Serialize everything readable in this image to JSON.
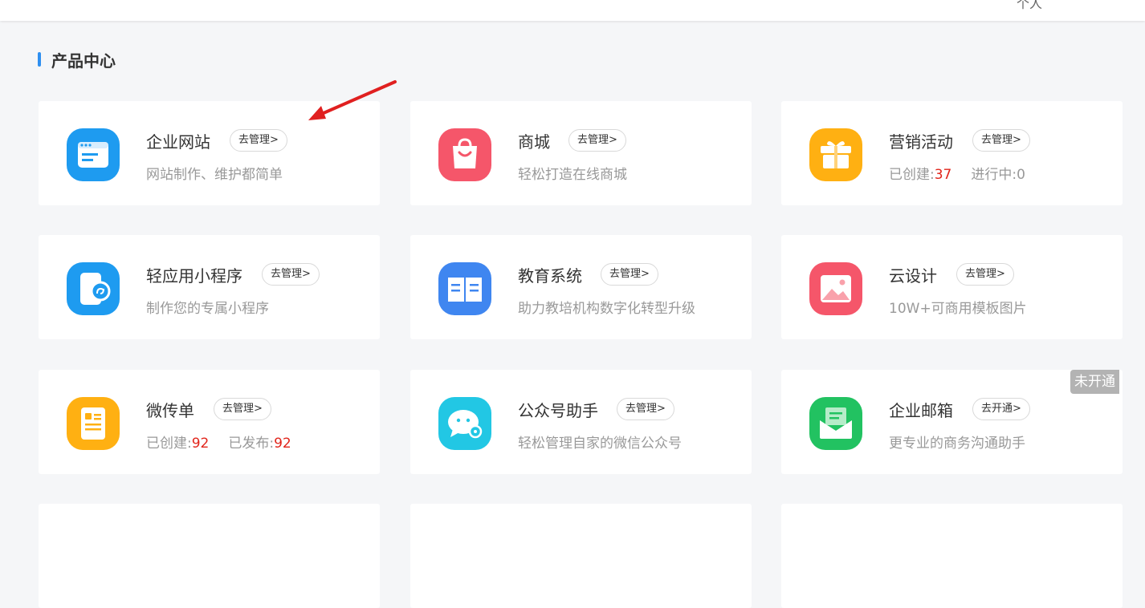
{
  "topbar": {
    "fragment": "个人"
  },
  "section": {
    "title": "产品中心"
  },
  "cards": [
    {
      "name": "企业网站",
      "button": "去管理>",
      "desc": "网站制作、维护都简单"
    },
    {
      "name": "商城",
      "button": "去管理>",
      "desc": "轻松打造在线商城"
    },
    {
      "name": "营销活动",
      "button": "去管理>",
      "stats": [
        {
          "label": "已创建:",
          "value": "37"
        },
        {
          "label": "进行中:",
          "value": "0"
        }
      ]
    },
    {
      "name": "轻应用小程序",
      "button": "去管理>",
      "desc": "制作您的专属小程序"
    },
    {
      "name": "教育系统",
      "button": "去管理>",
      "desc": "助力教培机构数字化转型升级"
    },
    {
      "name": "云设计",
      "button": "去管理>",
      "desc": "10W+可商用模板图片"
    },
    {
      "name": "微传单",
      "button": "去管理>",
      "stats": [
        {
          "label": "已创建:",
          "value": "92"
        },
        {
          "label": "已发布:",
          "value": "92"
        }
      ]
    },
    {
      "name": "公众号助手",
      "button": "去管理>",
      "desc": "轻松管理自家的微信公众号"
    },
    {
      "name": "企业邮箱",
      "button": "去开通>",
      "desc": "更专业的商务沟通助手",
      "badge": "未开通"
    }
  ],
  "icons": [
    {
      "name": "website-icon",
      "color": "#1e9bf0"
    },
    {
      "name": "shopping-bag-icon",
      "color": "#f5566a"
    },
    {
      "name": "gift-icon",
      "color": "#ffb012"
    },
    {
      "name": "mini-program-icon",
      "color": "#1e9bf0"
    },
    {
      "name": "book-icon",
      "color": "#3f86f0"
    },
    {
      "name": "image-icon",
      "color": "#f5566a"
    },
    {
      "name": "flyer-icon",
      "color": "#ffb012"
    },
    {
      "name": "wechat-chat-icon",
      "color": "#22c7e4"
    },
    {
      "name": "mail-icon",
      "color": "#22c261"
    }
  ],
  "colors": {
    "accent": "#2e8ff0",
    "stat_value": "#e1251b",
    "arrow": "#e02020"
  }
}
